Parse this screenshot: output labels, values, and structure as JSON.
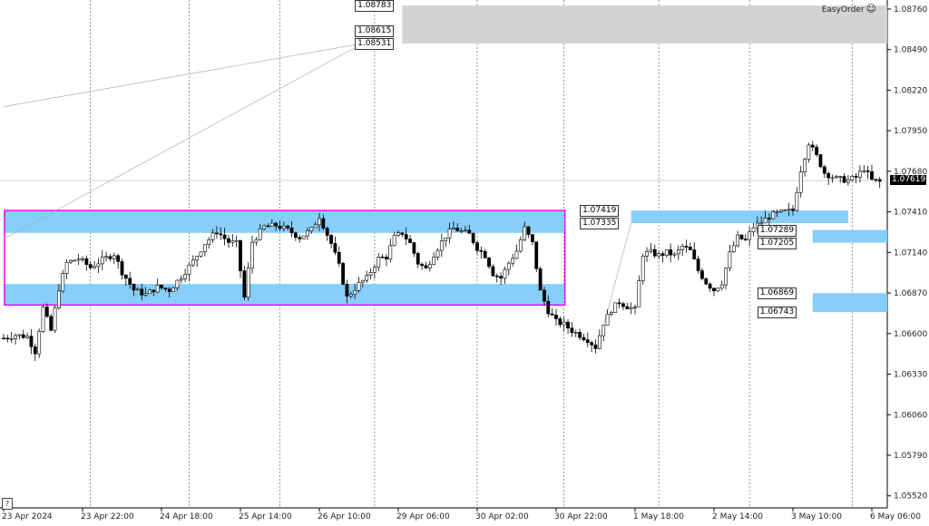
{
  "app": {
    "brand": "EasyOrder",
    "help": "?"
  },
  "colors": {
    "bg": "#ffffff",
    "grid": "#555555",
    "up_candle": "#ffffff",
    "down_candle": "#000000",
    "zone_fill": "#87cefa",
    "range_box": "#ff00ff",
    "top_zone": "#d3d3d3"
  },
  "chart_data": {
    "type": "candlestick",
    "symbol_price_current": "1.07619",
    "y_ticks": [
      "1.08760",
      "1.08490",
      "1.08220",
      "1.07950",
      "1.07680",
      "1.07410",
      "1.07140",
      "1.06870",
      "1.06600",
      "1.06330",
      "1.06060",
      "1.05790",
      "1.05520"
    ],
    "y_tick_values": [
      1.0876,
      1.0849,
      1.0822,
      1.0795,
      1.0768,
      1.0741,
      1.0714,
      1.0687,
      1.066,
      1.0633,
      1.0606,
      1.0579,
      1.0552
    ],
    "ylim": [
      1.0544,
      1.0882
    ],
    "x_ticks": [
      "23 Apr 2024",
      "23 Apr 22:00",
      "24 Apr 18:00",
      "25 Apr 14:00",
      "26 Apr 10:00",
      "29 Apr 06:00",
      "30 Apr 02:00",
      "30 Apr 22:00",
      "1 May 18:00",
      "2 May 14:00",
      "3 May 10:00",
      "6 May 06:00"
    ],
    "x_tick_bars": [
      0,
      20,
      40,
      60,
      80,
      100,
      120,
      140,
      160,
      180,
      200,
      220
    ],
    "bar_count": 225,
    "vlines_bar": [
      22,
      47,
      70,
      94,
      120,
      142,
      166,
      189,
      215
    ],
    "price_labels": [
      "1.08783",
      "1.08615",
      "1.08531",
      "1.07419",
      "1.07335",
      "1.07289",
      "1.07205",
      "1.06869",
      "1.06743"
    ],
    "zones": [
      {
        "kind": "top",
        "from_bar": 101,
        "to_bar": 225,
        "high": 1.08783,
        "low": 1.08531
      },
      {
        "kind": "range",
        "from_bar": 0,
        "to_bar": 142,
        "high": 1.07419,
        "low": 1.0727
      },
      {
        "kind": "range",
        "from_bar": 0,
        "to_bar": 142,
        "high": 1.0693,
        "low": 1.0679
      },
      {
        "kind": "right",
        "from_bar": 159,
        "to_bar": 214,
        "high": 1.07419,
        "low": 1.07335
      },
      {
        "kind": "right",
        "from_bar": 205,
        "to_bar": 225,
        "high": 1.07289,
        "low": 1.07205
      },
      {
        "kind": "right",
        "from_bar": 205,
        "to_bar": 225,
        "high": 1.06869,
        "low": 1.06743
      }
    ],
    "range_box": {
      "from_bar": 0,
      "to_bar": 142,
      "high": 1.07419,
      "low": 1.0679
    },
    "trend_lines": [
      {
        "from": [
          0,
          1.0811
        ],
        "to": [
          91,
          1.08531
        ]
      },
      {
        "from": [
          0,
          1.0723
        ],
        "to": [
          91,
          1.08531
        ]
      },
      {
        "from": [
          152,
          1.0665
        ],
        "to": [
          159,
          1.07335
        ]
      }
    ],
    "path": [
      [
        0,
        1.0657
      ],
      [
        3,
        1.0659
      ],
      [
        6,
        1.0658
      ],
      [
        8,
        1.0648
      ],
      [
        10,
        1.0677
      ],
      [
        12,
        1.0662
      ],
      [
        14,
        1.069
      ],
      [
        16,
        1.0707
      ],
      [
        19,
        1.071
      ],
      [
        22,
        1.0704
      ],
      [
        25,
        1.0709
      ],
      [
        28,
        1.0713
      ],
      [
        30,
        1.0701
      ],
      [
        33,
        1.0689
      ],
      [
        36,
        1.0686
      ],
      [
        39,
        1.0691
      ],
      [
        42,
        1.0689
      ],
      [
        45,
        1.0698
      ],
      [
        48,
        1.0708
      ],
      [
        51,
        1.072
      ],
      [
        54,
        1.0728
      ],
      [
        57,
        1.0721
      ],
      [
        59,
        1.072
      ],
      [
        61,
        1.0684
      ],
      [
        63,
        1.0721
      ],
      [
        66,
        1.0731
      ],
      [
        69,
        1.0732
      ],
      [
        72,
        1.0729
      ],
      [
        75,
        1.0724
      ],
      [
        78,
        1.0729
      ],
      [
        80,
        1.0738
      ],
      [
        83,
        1.072
      ],
      [
        85,
        1.0705
      ],
      [
        87,
        1.0684
      ],
      [
        90,
        1.0693
      ],
      [
        92,
        1.0697
      ],
      [
        95,
        1.071
      ],
      [
        97,
        1.0711
      ],
      [
        99,
        1.0724
      ],
      [
        101,
        1.0727
      ],
      [
        103,
        1.072
      ],
      [
        105,
        1.0707
      ],
      [
        107,
        1.0703
      ],
      [
        109,
        1.0713
      ],
      [
        112,
        1.0725
      ],
      [
        114,
        1.073
      ],
      [
        116,
        1.0728
      ],
      [
        118,
        1.0726
      ],
      [
        120,
        1.0717
      ],
      [
        122,
        1.0712
      ],
      [
        124,
        1.07
      ],
      [
        126,
        1.0697
      ],
      [
        128,
        1.0707
      ],
      [
        130,
        1.0715
      ],
      [
        132,
        1.073
      ],
      [
        134,
        1.072
      ],
      [
        136,
        1.0688
      ],
      [
        138,
        1.0675
      ],
      [
        140,
        1.0668
      ],
      [
        142,
        1.0666
      ],
      [
        144,
        1.0662
      ],
      [
        146,
        1.0659
      ],
      [
        148,
        1.0656
      ],
      [
        150,
        1.0651
      ],
      [
        152,
        1.0667
      ],
      [
        154,
        1.0676
      ],
      [
        156,
        1.0681
      ],
      [
        158,
        1.0678
      ],
      [
        160,
        1.0676
      ],
      [
        162,
        1.0713
      ],
      [
        164,
        1.0714
      ],
      [
        166,
        1.0712
      ],
      [
        168,
        1.0714
      ],
      [
        170,
        1.0712
      ],
      [
        172,
        1.0718
      ],
      [
        174,
        1.0715
      ],
      [
        176,
        1.0702
      ],
      [
        178,
        1.0694
      ],
      [
        180,
        1.0689
      ],
      [
        182,
        1.0694
      ],
      [
        184,
        1.0713
      ],
      [
        186,
        1.0724
      ],
      [
        188,
        1.0722
      ],
      [
        190,
        1.0731
      ],
      [
        192,
        1.0734
      ],
      [
        194,
        1.0738
      ],
      [
        196,
        1.074
      ],
      [
        198,
        1.0741
      ],
      [
        200,
        1.0742
      ],
      [
        202,
        1.0769
      ],
      [
        204,
        1.0787
      ],
      [
        206,
        1.0778
      ],
      [
        208,
        1.0767
      ],
      [
        211,
        1.0763
      ],
      [
        214,
        1.0762
      ],
      [
        216,
        1.0764
      ],
      [
        218,
        1.077
      ],
      [
        220,
        1.0762
      ],
      [
        222,
        1.0761
      ]
    ]
  }
}
